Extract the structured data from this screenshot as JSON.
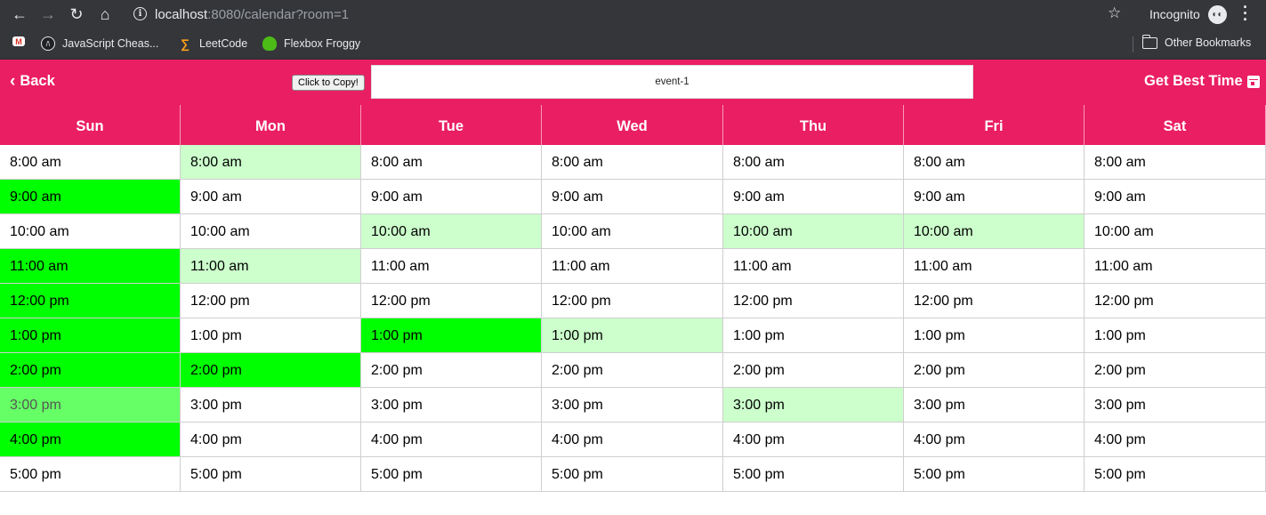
{
  "browser": {
    "url_host": "localhost",
    "url_rest": ":8080/calendar?room=1",
    "incognito_label": "Incognito",
    "bookmarks": [
      {
        "label": "",
        "icon": "gmail-icon"
      },
      {
        "label": "JavaScript Cheas...",
        "icon": "javascript-icon"
      },
      {
        "label": "LeetCode",
        "icon": "leetcode-icon"
      },
      {
        "label": "Flexbox Froggy",
        "icon": "frog-icon"
      }
    ],
    "other_bookmarks": "Other Bookmarks"
  },
  "header": {
    "back_label": "Back",
    "copy_label": "Click to Copy!",
    "room_value": "event-1",
    "best_time_label": "Get Best Time",
    "accent_color": "#ea1e63"
  },
  "calendar": {
    "days": [
      "Sun",
      "Mon",
      "Tue",
      "Wed",
      "Thu",
      "Fri",
      "Sat"
    ],
    "times": [
      "8:00 am",
      "9:00 am",
      "10:00 am",
      "11:00 am",
      "12:00 pm",
      "1:00 pm",
      "2:00 pm",
      "3:00 pm",
      "4:00 pm",
      "5:00 pm"
    ],
    "availability_colors": {
      "0": "#ffffff",
      "1": "#ccffcc",
      "2": "#66ff66",
      "3": "#00ff00"
    },
    "availability": [
      [
        0,
        1,
        0,
        0,
        0,
        0,
        0
      ],
      [
        3,
        0,
        0,
        0,
        0,
        0,
        0
      ],
      [
        0,
        0,
        1,
        0,
        1,
        1,
        0
      ],
      [
        3,
        1,
        0,
        0,
        0,
        0,
        0
      ],
      [
        3,
        0,
        0,
        0,
        0,
        0,
        0
      ],
      [
        3,
        0,
        3,
        1,
        0,
        0,
        0
      ],
      [
        3,
        3,
        0,
        0,
        0,
        0,
        0
      ],
      [
        2,
        0,
        0,
        0,
        1,
        0,
        0
      ],
      [
        3,
        0,
        0,
        0,
        0,
        0,
        0
      ],
      [
        0,
        0,
        0,
        0,
        0,
        0,
        0
      ]
    ]
  }
}
